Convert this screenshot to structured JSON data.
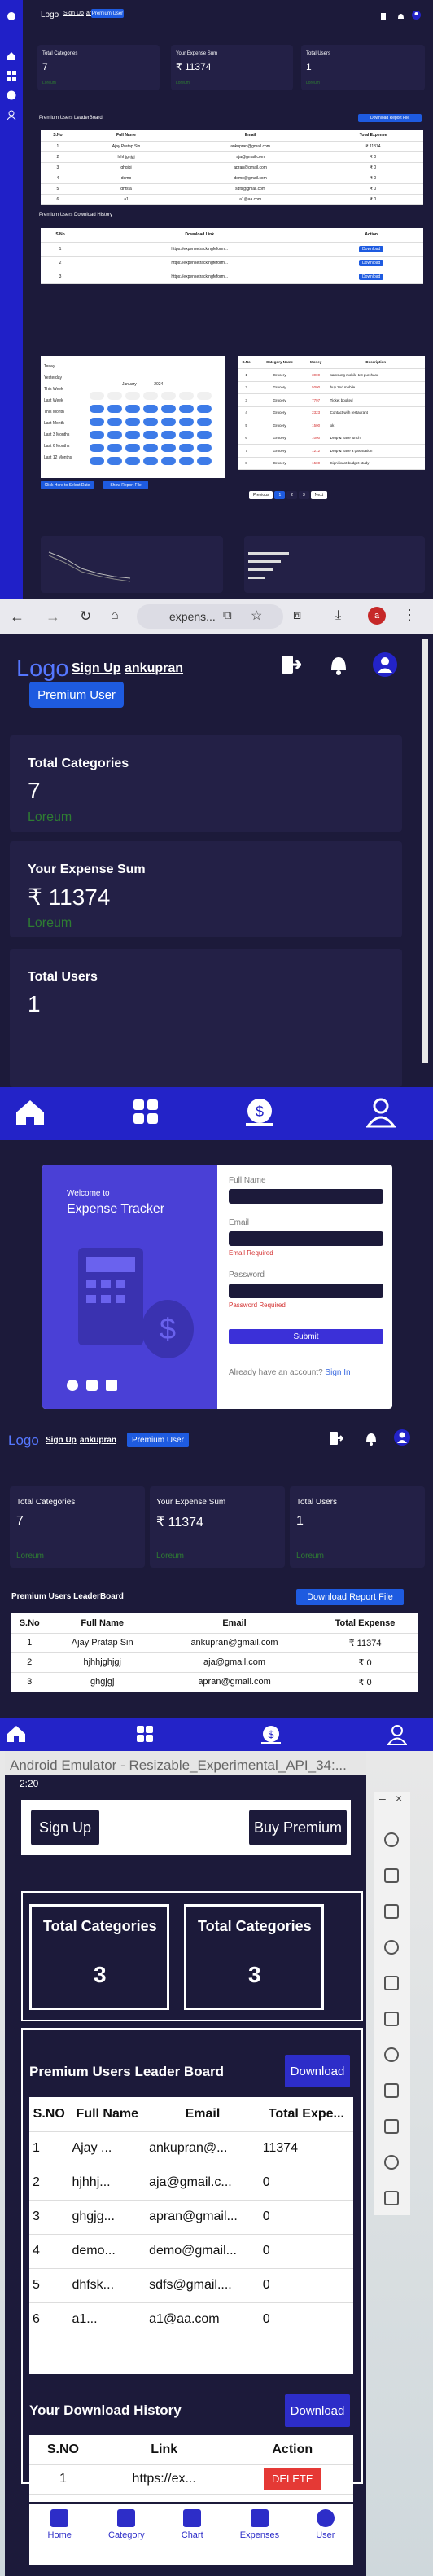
{
  "p1": {
    "logo": "Logo",
    "signup": "Sign Up",
    "user": "ankupran",
    "premium_btn": "Premium User",
    "cards": [
      {
        "label": "Total Categories",
        "value": "7",
        "foot": "Loreum"
      },
      {
        "label": "Your Expense Sum",
        "value": "₹ 11374",
        "foot": "Loreum"
      },
      {
        "label": "Total Users",
        "value": "1",
        "foot": "Loreum"
      }
    ],
    "leaderboard_title": "Premium Users LeaderBoard",
    "download_report": "Download Report File",
    "lb_headers": [
      "S.No",
      "Full Name",
      "Email",
      "Total Expense"
    ],
    "lb_rows": [
      [
        "1",
        "Ajay Pratap Sin",
        "ankupran@gmail.com",
        "₹ 11374"
      ],
      [
        "2",
        "hjhhjghjgj",
        "aja@gmail.com",
        "₹ 0"
      ],
      [
        "3",
        "ghgjgj",
        "apran@gmail.com",
        "₹ 0"
      ],
      [
        "4",
        "demo",
        "demo@gmail.com",
        "₹ 0"
      ],
      [
        "5",
        "dhfsfa",
        "sdfs@gmail.com",
        "₹ 0"
      ],
      [
        "6",
        "a1",
        "a1@aa.com",
        "₹ 0"
      ]
    ],
    "history_title": "Premium Users Download History",
    "dh_headers": [
      "S.No",
      "Download Link",
      "Action"
    ],
    "dh_rows": [
      [
        "1",
        "https://expensetrackingfeform...",
        "Download"
      ],
      [
        "2",
        "https://expensetrackingfeform...",
        "Download"
      ],
      [
        "3",
        "https://expensetrackingfeform...",
        "Download"
      ]
    ],
    "date_btn1": "Click Here to Select Date",
    "date_btn2": "Show Report File",
    "ex_headers": [
      "S.No",
      "Category Name",
      "Money",
      "Description"
    ],
    "ex_rows": [
      [
        "1",
        "Grocery",
        "3000",
        "samsung mobile 1st purchase"
      ],
      [
        "2",
        "Grocery",
        "5000",
        "buy 2nd mobile"
      ],
      [
        "3",
        "Grocery",
        "7797",
        "Ticket booked"
      ],
      [
        "4",
        "Grocery",
        "2323",
        "Contact with restaurant"
      ],
      [
        "5",
        "Grocery",
        "1500",
        "ok"
      ],
      [
        "6",
        "Grocery",
        "1000",
        "Drop & have lunch"
      ],
      [
        "7",
        "Grocery",
        "1212",
        "Drop & have a gas station"
      ],
      [
        "8",
        "Grocery",
        "1500",
        "Significant budget study"
      ]
    ],
    "pager": [
      "Previous",
      "1",
      "2",
      "3",
      "Next"
    ],
    "month": "January",
    "year": "2024",
    "date_list": [
      "Today",
      "Yesterday",
      "This Week",
      "Last Week",
      "This Month",
      "Last Month",
      "Last 3 Months",
      "Last 6 Months",
      "Last 12 Months"
    ]
  },
  "p2": {
    "url": "expens...",
    "logo": "Logo",
    "signup": "Sign Up",
    "user": "ankupran",
    "premium_btn": "Premium User",
    "cards": [
      {
        "label": "Total Categories",
        "value": "7",
        "foot": "Loreum"
      },
      {
        "label": "Your Expense Sum",
        "value": "₹ 11374",
        "foot": "Loreum"
      },
      {
        "label": "Total Users",
        "value": "1",
        "foot": ""
      }
    ]
  },
  "p3": {
    "welcome": "Welcome to",
    "title": "Expense Tracker",
    "full_name": "Full Name",
    "email": "Email",
    "email_err": "Email Required",
    "password": "Password",
    "password_err": "Password Required",
    "submit": "Submit",
    "have_account": "Already have an account?",
    "sign_in": "Sign In"
  },
  "p4": {
    "logo": "Logo",
    "signup": "Sign Up",
    "user": "ankupran",
    "premium_btn": "Premium User",
    "cards": [
      {
        "label": "Total Categories",
        "value": "7",
        "foot": "Loreum"
      },
      {
        "label": "Your Expense Sum",
        "value": "₹ 11374",
        "foot": "Loreum"
      },
      {
        "label": "Total Users",
        "value": "1",
        "foot": "Loreum"
      }
    ],
    "leaderboard_title": "Premium Users LeaderBoard",
    "download_report": "Download Report File",
    "lb_headers": [
      "S.No",
      "Full Name",
      "Email",
      "Total Expense"
    ],
    "lb_rows": [
      [
        "1",
        "Ajay Pratap Sin",
        "ankupran@gmail.com",
        "₹ 11374"
      ],
      [
        "2",
        "hjhhjghjgj",
        "aja@gmail.com",
        "₹ 0"
      ],
      [
        "3",
        "ghgjgj",
        "apran@gmail.com",
        "₹ 0"
      ]
    ]
  },
  "p5": {
    "title": "Android Emulator - Resizable_Experimental_API_34:...",
    "time": "2:20",
    "signup": "Sign Up",
    "buy_premium": "Buy Premium",
    "cards": [
      {
        "label": "Total Categories",
        "value": "3"
      },
      {
        "label": "Total Categories",
        "value": "3"
      }
    ],
    "lb_title": "Premium Users Leader Board",
    "download": "Download",
    "lb_headers": [
      "S.NO",
      "Full Name",
      "Email",
      "Total Expe..."
    ],
    "lb_rows": [
      [
        "1",
        "Ajay ...",
        "ankupran@...",
        "11374"
      ],
      [
        "2",
        "hjhhj...",
        "aja@gmail.c...",
        "0"
      ],
      [
        "3",
        "ghgjg...",
        "apran@gmail...",
        "0"
      ],
      [
        "4",
        "demo...",
        "demo@gmail...",
        "0"
      ],
      [
        "5",
        "dhfsk...",
        "sdfs@gmail....",
        "0"
      ],
      [
        "6",
        "a1...",
        "a1@aa.com",
        "0"
      ]
    ],
    "dh_title": "Your Download History",
    "dh_download": "Download",
    "dh_headers": [
      "S.NO",
      "Link",
      "Action"
    ],
    "dh_row": [
      "1",
      "https://ex...",
      "DELETE"
    ],
    "tabs": [
      "Home",
      "Category",
      "Chart",
      "Expenses",
      "User"
    ]
  },
  "colors": {
    "bg": "#1c1a3a",
    "card": "#232046",
    "accent": "#1e5be0",
    "nav": "#2323c8",
    "loreum": "#2e7d32",
    "error": "#d32f2f",
    "delete": "#e53935"
  }
}
